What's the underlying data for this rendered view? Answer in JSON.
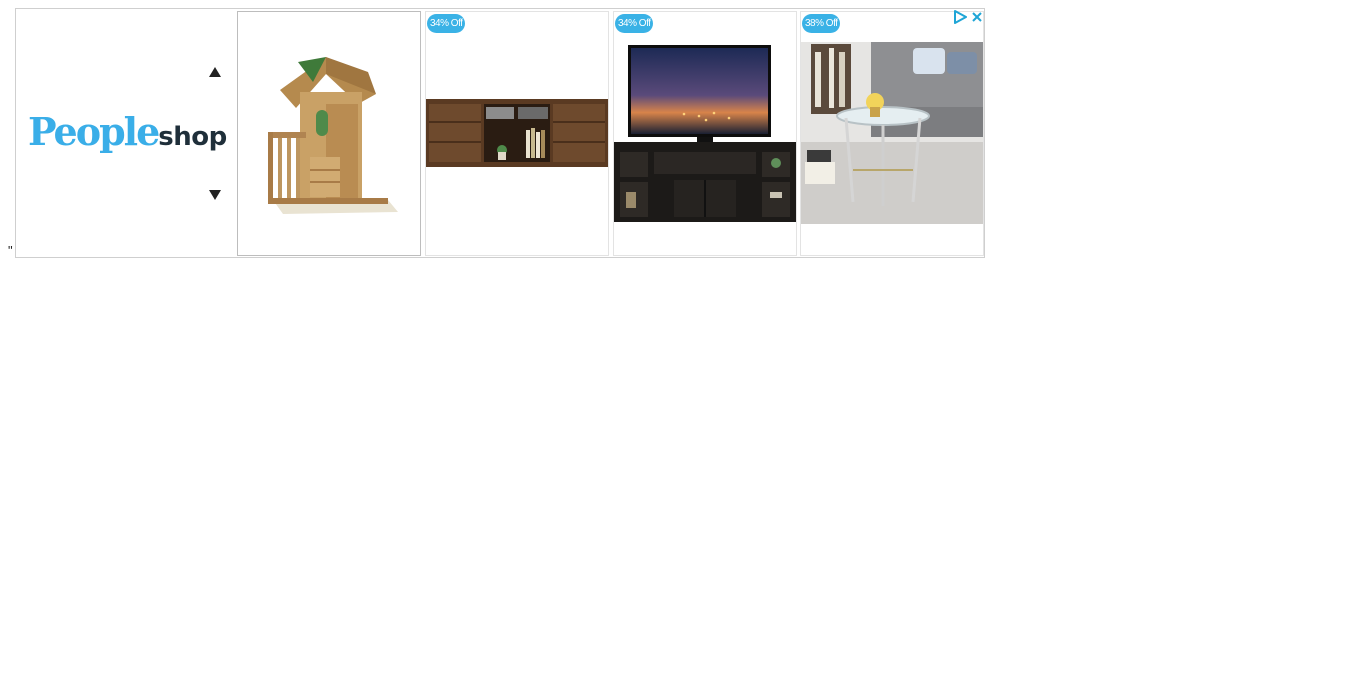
{
  "stray_text": "\"",
  "ad": {
    "brand": {
      "name_main": "People",
      "name_sub": "shop",
      "color_main": "#3aaee8",
      "color_sub": "#1f2f3a"
    },
    "nav": {
      "up_icon": "triangle-up-icon",
      "down_icon": "triangle-down-icon"
    },
    "products": [
      {
        "name": "wooden-playhouse",
        "badge": ""
      },
      {
        "name": "wood-tv-console",
        "badge": "34% Off"
      },
      {
        "name": "black-tv-stand-with-tv",
        "badge": "34% Off"
      },
      {
        "name": "glass-side-table",
        "badge": "38% Off"
      }
    ],
    "badge_color": "#3ab2e6",
    "adchoices_icon": "adchoices-play-icon",
    "close_icon": "close-icon"
  }
}
